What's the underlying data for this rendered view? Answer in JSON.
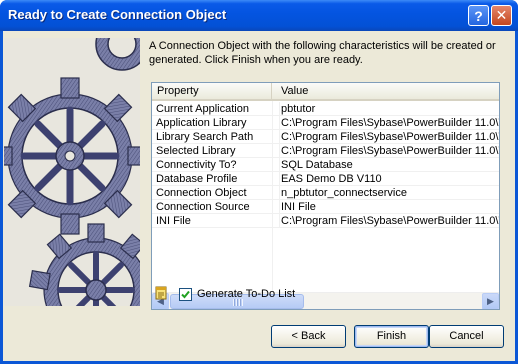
{
  "window": {
    "title": "Ready to Create Connection Object",
    "help_glyph": "?",
    "close_glyph": "✕"
  },
  "intro_text": "A Connection Object with the following characteristics will be created or generated.  Click Finish when you are ready.",
  "list": {
    "headers": [
      "Property",
      "Value"
    ],
    "rows": [
      {
        "property": "Current Application",
        "value": "pbtutor"
      },
      {
        "property": "Application Library",
        "value": "C:\\Program Files\\Sybase\\PowerBuilder 11.0\\Tu"
      },
      {
        "property": "Library Search Path",
        "value": "C:\\Program Files\\Sybase\\PowerBuilder 11.0\\Tu"
      },
      {
        "property": "Selected Library",
        "value": "C:\\Program Files\\Sybase\\PowerBuilder 11.0\\Tu"
      },
      {
        "property": "Connectivity To?",
        "value": "SQL Database"
      },
      {
        "property": "Database Profile",
        "value": "EAS Demo DB V110"
      },
      {
        "property": "Connection Object",
        "value": "n_pbtutor_connectservice"
      },
      {
        "property": "Connection Source",
        "value": "INI File"
      },
      {
        "property": "INI File",
        "value": "C:\\Program Files\\Sybase\\PowerBuilder 11.0\\Tu"
      }
    ],
    "scroll_left_glyph": "◀",
    "scroll_right_glyph": "▶"
  },
  "todo": {
    "checked": true,
    "label": "Generate To-Do List",
    "icon": "notepad-icon"
  },
  "buttons": {
    "back": "< Back",
    "finish": "Finish",
    "cancel": "Cancel"
  },
  "colors": {
    "titlebar": "#0454e0",
    "dialog_bg": "#ece9d8",
    "list_border": "#7f9db9",
    "button_border": "#003c74"
  }
}
